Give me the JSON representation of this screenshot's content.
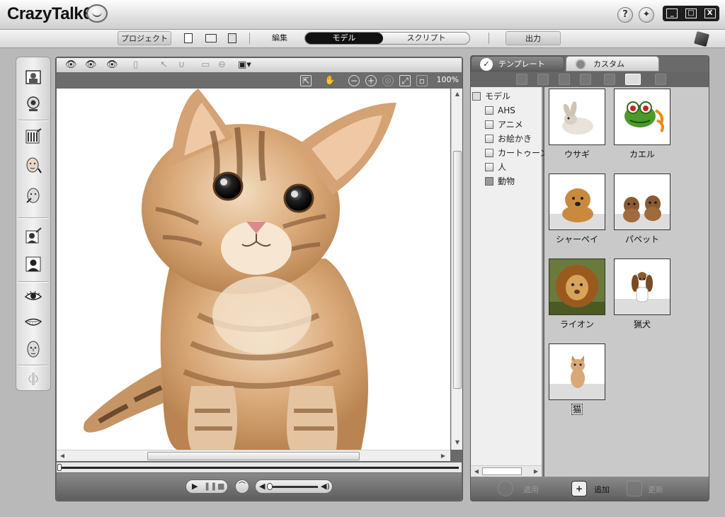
{
  "app": {
    "title": "CrazyTalk6"
  },
  "window_controls": {
    "minimize": "_",
    "maximize": "□",
    "close": "X"
  },
  "help": {
    "label": "?"
  },
  "menubar": {
    "project": "プロジェクト",
    "edit": "編集",
    "model": "モデル",
    "script": "スクリプト",
    "output": "出力"
  },
  "viewer": {
    "zoom_level": "100%"
  },
  "right_panel": {
    "tabs": [
      {
        "label": "テンプレート"
      },
      {
        "label": "カスタム"
      }
    ],
    "tree": {
      "root": "モデル",
      "items": [
        {
          "label": "AHS"
        },
        {
          "label": "アニメ"
        },
        {
          "label": "お絵かき"
        },
        {
          "label": "カートゥーン"
        },
        {
          "label": "人"
        },
        {
          "label": "動物"
        }
      ]
    },
    "thumbnails": [
      {
        "label": "ウサギ"
      },
      {
        "label": "カエル"
      },
      {
        "label": "シャーペイ"
      },
      {
        "label": "パペット"
      },
      {
        "label": "ライオン"
      },
      {
        "label": "猟犬"
      },
      {
        "label": "猫"
      }
    ],
    "bottom": {
      "apply": "適用",
      "add": "追加",
      "update": "更新"
    }
  }
}
